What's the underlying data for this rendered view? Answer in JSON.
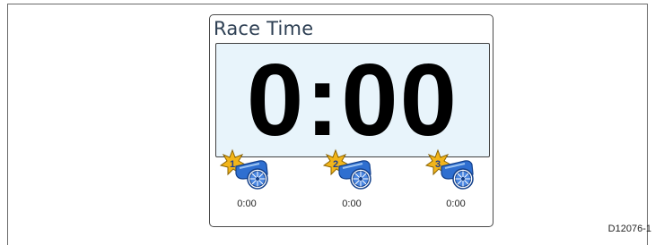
{
  "panel": {
    "title": "Race Time",
    "main_time": "0:00"
  },
  "guns": [
    {
      "number": "1",
      "time": "0:00",
      "icon": "cannon-1-icon"
    },
    {
      "number": "2",
      "time": "0:00",
      "icon": "cannon-2-icon"
    },
    {
      "number": "3",
      "time": "0:00",
      "icon": "cannon-3-icon"
    }
  ],
  "figure_code": "D12076-1",
  "colors": {
    "display_bg": "#e8f4fb",
    "star": "#f2b51a",
    "cannon": "#2f6fd0",
    "title": "#2d3f53"
  }
}
